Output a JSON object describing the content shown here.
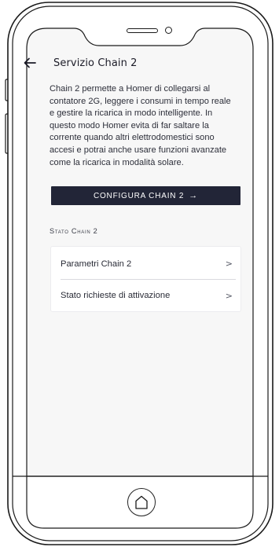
{
  "header": {
    "back_icon": "arrow-left-icon",
    "title": "Servizio Chain 2"
  },
  "description": {
    "lines": [
      "Chain 2 permette a Homer di collegarsi al",
      "contatore 2G, leggere i consumi in tempo reale",
      "e gestire la ricarica in modo intelligente. In",
      "questo modo Homer evita di far saltare la",
      "corrente quando altri elettrodomestici sono",
      "accesi e potrai anche usare funzioni avanzate",
      "come la ricarica in modalità solare."
    ]
  },
  "cta": {
    "label": "CONFIGURA CHAIN 2",
    "arrow": "→",
    "bg_color": "#222537"
  },
  "section": {
    "label": "Stato Chain 2"
  },
  "list": {
    "items": [
      {
        "label": "Parametri Chain 2",
        "chevron": ">"
      },
      {
        "label": "Stato richieste di attivazione",
        "chevron": ">"
      }
    ]
  },
  "device": {
    "home_icon": "home-icon"
  }
}
